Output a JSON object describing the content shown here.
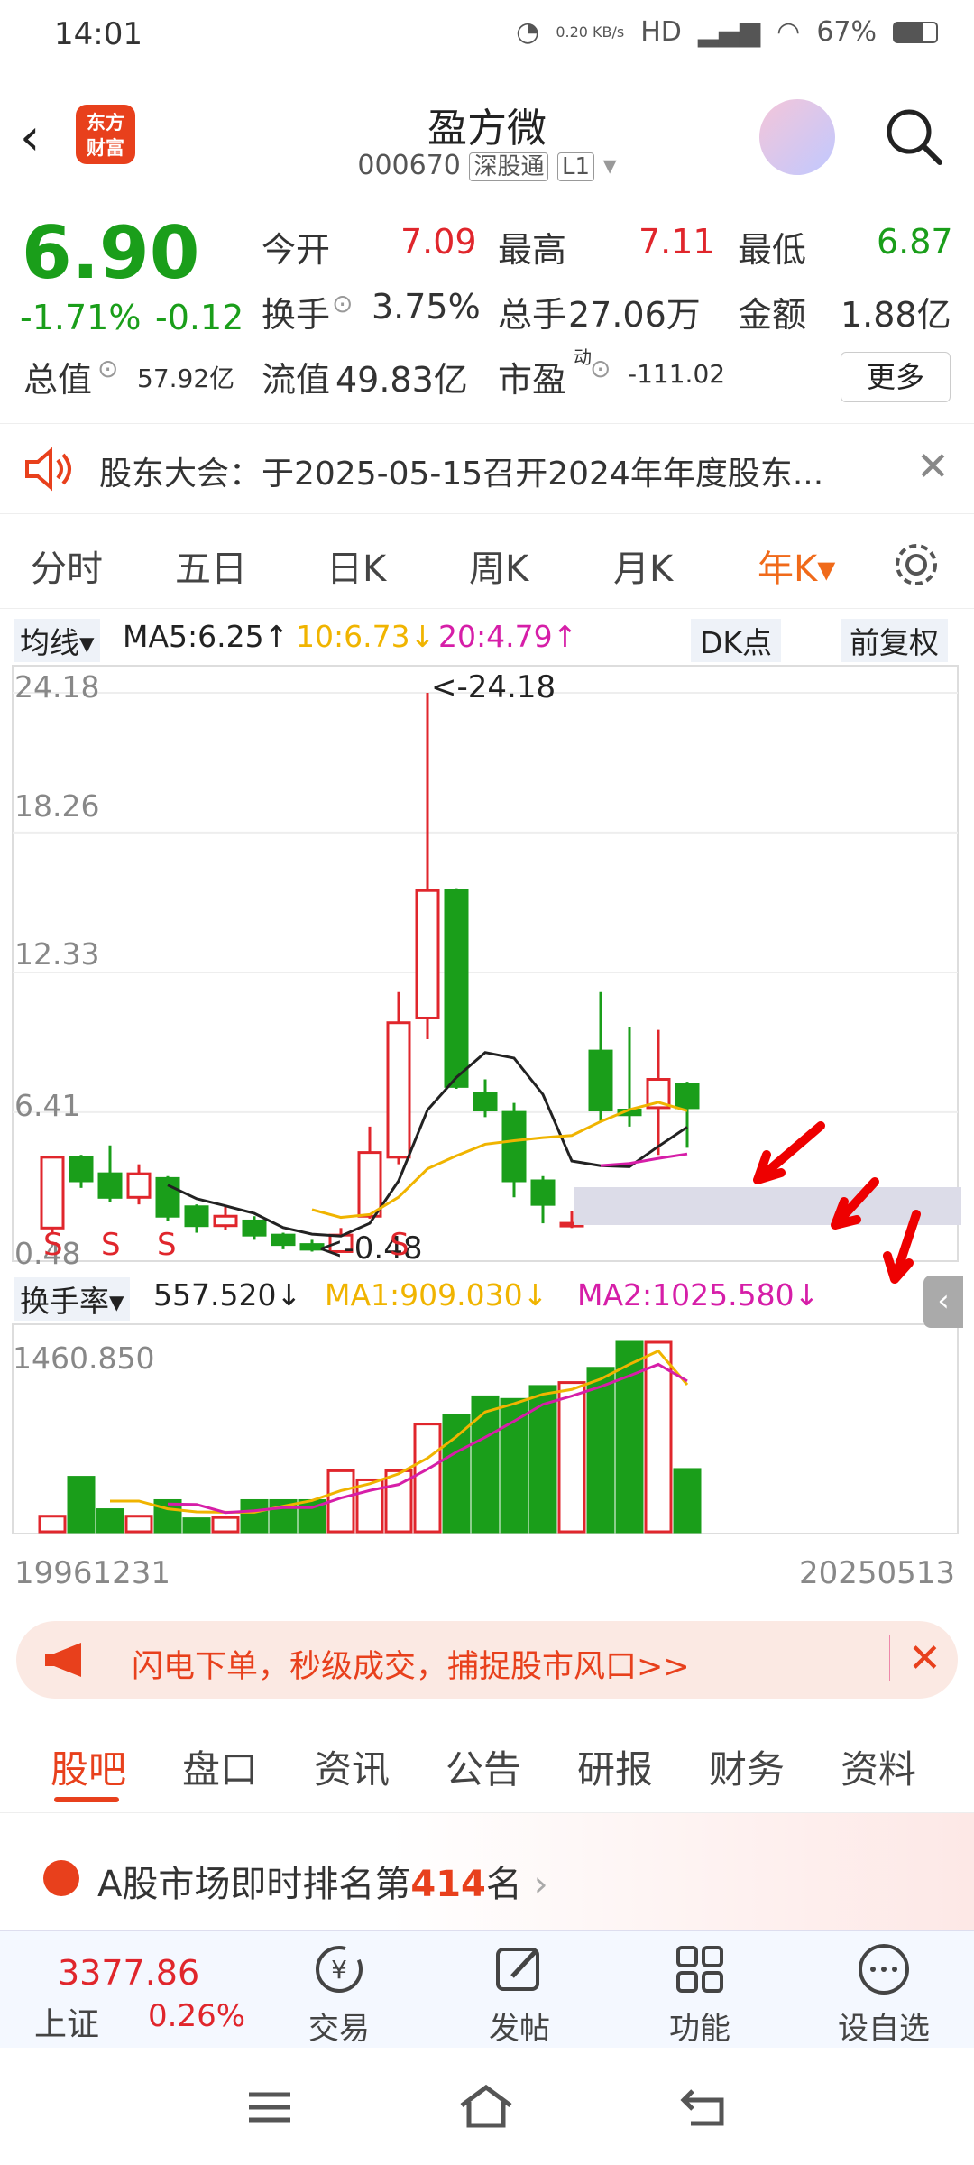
{
  "status": {
    "time": "14:01",
    "net": "0.20 KB/s",
    "battery": "67%"
  },
  "header": {
    "logo": "东方财富",
    "title": "盈方微",
    "code": "000670",
    "tag1": "深股通",
    "tag2": "L1"
  },
  "quote": {
    "price": "6.90",
    "pct": "-1.71%",
    "chg": "-0.12",
    "total_value_label": "总值",
    "total_value": "57.92亿",
    "open_label": "今开",
    "open": "7.09",
    "high_label": "最高",
    "high": "7.11",
    "low_label": "最低",
    "low": "6.87",
    "turnover_label": "换手",
    "turnover": "3.75%",
    "volume_label": "总手",
    "volume": "27.06万",
    "amount_label": "金额",
    "amount": "1.88亿",
    "float_label": "流值",
    "float_value": "49.83亿",
    "pe_label": "市盈",
    "pe_sup": "动",
    "pe": "-111.02",
    "more": "更多"
  },
  "notice": {
    "text": "股东大会：于2025-05-15召开2024年年度股东..."
  },
  "tabs": [
    {
      "label": "分时"
    },
    {
      "label": "五日"
    },
    {
      "label": "日K"
    },
    {
      "label": "周K"
    },
    {
      "label": "月K"
    },
    {
      "label": "年K▾"
    }
  ],
  "indicator": {
    "ma_selector": "均线▾",
    "ma5": "MA5:6.25↑",
    "ma10": "10:6.73↓",
    "ma20": "20:4.79↑",
    "dk": "DK点",
    "fq": "前复权"
  },
  "chart_labels": {
    "y_ticks": [
      "24.18",
      "18.26",
      "12.33",
      "6.41",
      "0.48"
    ],
    "max_label": "<-24.18",
    "min_label": "<-0.48",
    "sig": "S"
  },
  "volume": {
    "selector": "换手率▾",
    "value": "557.520↓",
    "ma1": "MA1:909.030↓",
    "ma2": "MA2:1025.580↓",
    "y_max": "1460.850",
    "date_start": "19961231",
    "date_end": "20250513"
  },
  "colors": {
    "up": "#e0262c",
    "down": "#1a9e1a",
    "accent": "#f06a1a",
    "ma5": "#222222",
    "ma10": "#f0b400",
    "ma20": "#d61ea8"
  },
  "chart_data": {
    "type": "candlestick",
    "ylim": [
      0.48,
      24.18
    ],
    "candles": [
      {
        "o": 1.5,
        "c": 4.5,
        "h": 4.5,
        "l": 1.3,
        "up": true
      },
      {
        "o": 4.5,
        "c": 3.5,
        "h": 4.6,
        "l": 3.2,
        "up": false
      },
      {
        "o": 3.8,
        "c": 2.8,
        "h": 5.0,
        "l": 2.6,
        "up": false
      },
      {
        "o": 2.8,
        "c": 3.8,
        "h": 4.2,
        "l": 2.5,
        "up": true
      },
      {
        "o": 3.6,
        "c": 2.0,
        "h": 3.7,
        "l": 1.8,
        "up": false
      },
      {
        "o": 2.4,
        "c": 1.6,
        "h": 2.5,
        "l": 1.3,
        "up": false
      },
      {
        "o": 1.6,
        "c": 2.0,
        "h": 2.4,
        "l": 1.4,
        "up": true
      },
      {
        "o": 1.8,
        "c": 1.2,
        "h": 2.0,
        "l": 1.0,
        "up": false
      },
      {
        "o": 1.2,
        "c": 0.8,
        "h": 1.3,
        "l": 0.6,
        "up": false
      },
      {
        "o": 0.8,
        "c": 0.6,
        "h": 1.0,
        "l": 0.5,
        "up": false
      },
      {
        "o": 0.5,
        "c": 1.2,
        "h": 1.5,
        "l": 0.48,
        "up": true
      },
      {
        "o": 2.0,
        "c": 4.7,
        "h": 5.8,
        "l": 1.9,
        "up": true
      },
      {
        "o": 4.5,
        "c": 10.2,
        "h": 11.5,
        "l": 4.2,
        "up": true
      },
      {
        "o": 10.4,
        "c": 15.8,
        "h": 24.18,
        "l": 9.5,
        "up": true
      },
      {
        "o": 15.8,
        "c": 7.5,
        "h": 15.9,
        "l": 7.4,
        "up": false
      },
      {
        "o": 7.2,
        "c": 6.5,
        "h": 7.8,
        "l": 6.2,
        "up": false
      },
      {
        "o": 6.4,
        "c": 3.5,
        "h": 6.8,
        "l": 2.8,
        "up": false
      },
      {
        "o": 3.5,
        "c": 2.5,
        "h": 3.7,
        "l": 1.7,
        "up": false
      },
      {
        "o": 1.6,
        "c": 1.7,
        "h": 2.2,
        "l": 1.5,
        "up": true
      },
      {
        "o": 9.0,
        "c": 6.5,
        "h": 11.5,
        "l": 6.0,
        "up": false
      },
      {
        "o": 6.5,
        "c": 6.3,
        "h": 10.0,
        "l": 5.8,
        "up": false
      },
      {
        "o": 6.6,
        "c": 7.8,
        "h": 9.9,
        "l": 4.6,
        "up": true
      },
      {
        "o": 7.6,
        "c": 6.6,
        "h": 7.7,
        "l": 4.9,
        "up": false
      }
    ],
    "volume": [
      120,
      420,
      170,
      120,
      240,
      100,
      110,
      240,
      240,
      240,
      470,
      400,
      470,
      830,
      900,
      1040,
      1020,
      1120,
      1150,
      1260,
      1460,
      1460,
      480
    ]
  },
  "banner": {
    "text": "闪电下单，秒级成交，捕捉股市风口>>"
  },
  "subtabs": [
    {
      "label": "股吧"
    },
    {
      "label": "盘口"
    },
    {
      "label": "资讯"
    },
    {
      "label": "公告"
    },
    {
      "label": "研报"
    },
    {
      "label": "财务"
    },
    {
      "label": "资料"
    }
  ],
  "rank": {
    "prefix": "A股市场即时排名第",
    "num": "414",
    "suffix": "名"
  },
  "navbar": {
    "index_val": "3377.86",
    "index_name": "上证",
    "index_pct": "0.26%",
    "items": [
      {
        "label": "交易"
      },
      {
        "label": "发帖"
      },
      {
        "label": "功能"
      },
      {
        "label": "设自选"
      }
    ]
  }
}
